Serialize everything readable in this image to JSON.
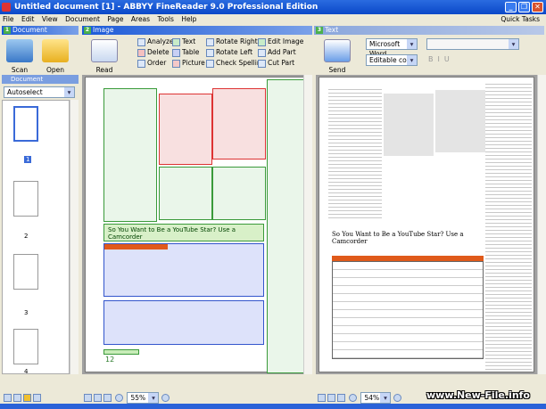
{
  "window": {
    "title": "Untitled document [1] - ABBYY FineReader 9.0 Professional Edition"
  },
  "menu": [
    "File",
    "Edit",
    "View",
    "Document",
    "Page",
    "Areas",
    "Tools",
    "Help"
  ],
  "quick_tasks": "Quick Tasks",
  "panels": {
    "document": {
      "num": "1",
      "title": "Document",
      "scan": "Scan",
      "open": "Open",
      "languages_header": "Document Languages",
      "language": "Autoselect",
      "pages": [
        "1",
        "2",
        "3",
        "4"
      ],
      "current_page": "4"
    },
    "image": {
      "num": "2",
      "title": "Image",
      "read": "Read",
      "tools": [
        "Analyze",
        "Delete",
        "Order",
        "Text",
        "Table",
        "Picture",
        "Rotate Right",
        "Rotate Left",
        "Check Spelling",
        "Edit Image",
        "Add Part",
        "Cut Part"
      ],
      "zoom": "55%",
      "page_number": "12",
      "headline": "So You Want to Be a YouTube Star? Use a Camcorder"
    },
    "text": {
      "num": "3",
      "title": "Text",
      "send": "Send",
      "format": "Microsoft Word",
      "mode": "Editable copy",
      "zoom": "54%",
      "headline": "So You Want to Be a YouTube Star? Use a Camcorder"
    }
  },
  "watermark": "www.New-File.info",
  "colors": {
    "titlebar": "#0a48c8",
    "panel_header": "#1c5ad8",
    "area_text": "#3a9a3a",
    "area_table": "#3355cc",
    "table_header": "#e05a1a"
  }
}
